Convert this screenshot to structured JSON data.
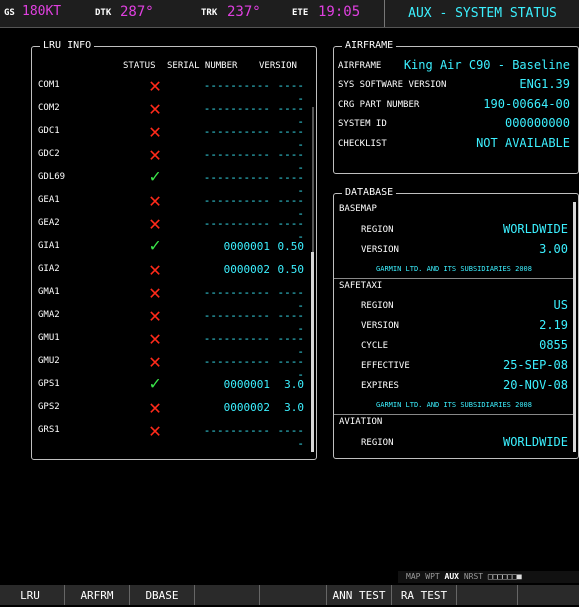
{
  "topbar": {
    "gs_label": "GS",
    "gs_value": "180KT",
    "dtk_label": "DTK",
    "dtk_value": "287°",
    "trk_label": "TRK",
    "trk_value": "237°",
    "ete_label": "ETE",
    "ete_value": "19:05",
    "page_title": "AUX - SYSTEM STATUS"
  },
  "lru_info": {
    "title": "LRU INFO",
    "headers": {
      "status": "STATUS",
      "serial": "SERIAL NUMBER",
      "version": "VERSION"
    },
    "rows": [
      {
        "name": "COM1",
        "status": "fail",
        "serial": "----------",
        "version": "-----"
      },
      {
        "name": "COM2",
        "status": "fail",
        "serial": "----------",
        "version": "-----"
      },
      {
        "name": "GDC1",
        "status": "fail",
        "serial": "----------",
        "version": "-----"
      },
      {
        "name": "GDC2",
        "status": "fail",
        "serial": "----------",
        "version": "-----"
      },
      {
        "name": "GDL69",
        "status": "ok",
        "serial": "----------",
        "version": "-----"
      },
      {
        "name": "GEA1",
        "status": "fail",
        "serial": "----------",
        "version": "-----"
      },
      {
        "name": "GEA2",
        "status": "fail",
        "serial": "----------",
        "version": "-----"
      },
      {
        "name": "GIA1",
        "status": "ok",
        "serial": "0000001",
        "version": "0.50"
      },
      {
        "name": "GIA2",
        "status": "fail",
        "serial": "0000002",
        "version": "0.50"
      },
      {
        "name": "GMA1",
        "status": "fail",
        "serial": "----------",
        "version": "-----"
      },
      {
        "name": "GMA2",
        "status": "fail",
        "serial": "----------",
        "version": "-----"
      },
      {
        "name": "GMU1",
        "status": "fail",
        "serial": "----------",
        "version": "-----"
      },
      {
        "name": "GMU2",
        "status": "fail",
        "serial": "----------",
        "version": "-----"
      },
      {
        "name": "GPS1",
        "status": "ok",
        "serial": "0000001",
        "version": "3.0"
      },
      {
        "name": "GPS2",
        "status": "fail",
        "serial": "0000002",
        "version": "3.0"
      },
      {
        "name": "GRS1",
        "status": "fail",
        "serial": "----------",
        "version": "-----"
      }
    ]
  },
  "airframe": {
    "title": "AIRFRAME",
    "airframe_label": "AIRFRAME",
    "airframe_value": "King Air C90 - Baseline",
    "sw_label": "SYS SOFTWARE VERSION",
    "sw_value": "ENG1.39",
    "crg_label": "CRG PART NUMBER",
    "crg_value": "190-00664-00",
    "sysid_label": "SYSTEM ID",
    "sysid_value": "000000000",
    "checklist_label": "CHECKLIST",
    "checklist_value": "NOT AVAILABLE"
  },
  "database": {
    "title": "DATABASE",
    "basemap": {
      "heading": "BASEMAP",
      "region_label": "REGION",
      "region": "WORLDWIDE",
      "version_label": "VERSION",
      "version": "3.00",
      "note": "GARMIN LTD. AND ITS SUBSIDIARIES 2008"
    },
    "safetaxi": {
      "heading": "SAFETAXI",
      "region_label": "REGION",
      "region": "US",
      "version_label": "VERSION",
      "version": "2.19",
      "cycle_label": "CYCLE",
      "cycle": "0855",
      "effective_label": "EFFECTIVE",
      "effective": "25-SEP-08",
      "expires_label": "EXPIRES",
      "expires": "20-NOV-08",
      "note": "GARMIN LTD. AND ITS SUBSIDIARIES 2008"
    },
    "aviation": {
      "heading": "AVIATION",
      "region_label": "REGION",
      "region": "WORLDWIDE"
    }
  },
  "page_group": {
    "pre": "MAP WPT",
    "active": "AUX",
    "post": "NRST",
    "dots": "□□□□□□■"
  },
  "softkeys": {
    "lru": "LRU",
    "arfrm": "ARFRM",
    "dbase": "DBASE",
    "ann_test": "ANN TEST",
    "ra_test": "RA TEST"
  },
  "colors": {
    "cyan": "#3cf0ff",
    "magenta": "#e040e0",
    "red": "#ff2a1a",
    "green": "#3ae84a"
  }
}
